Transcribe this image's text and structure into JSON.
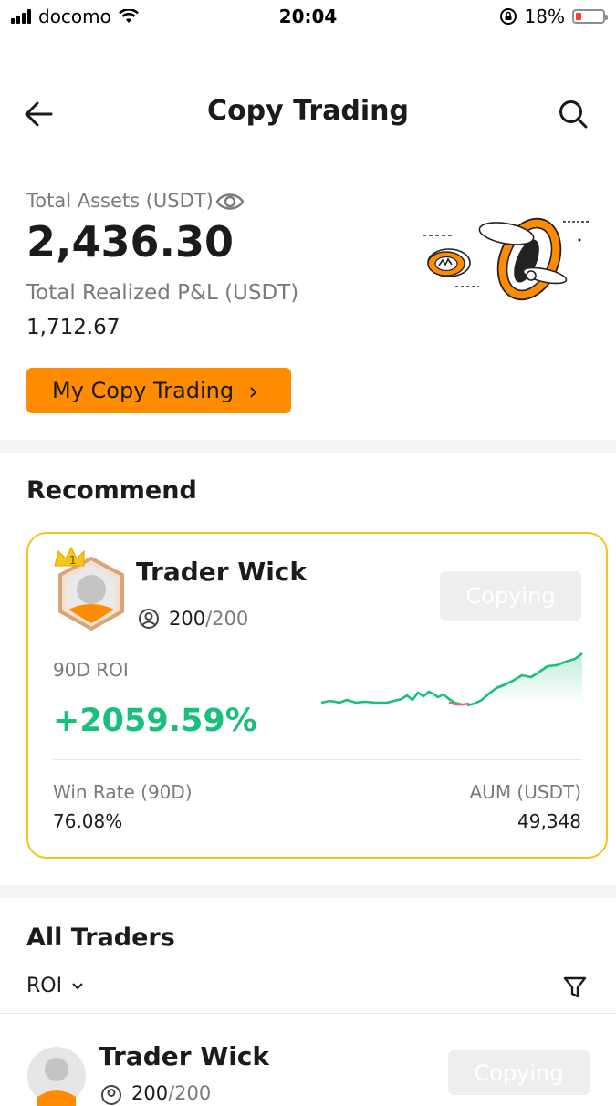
{
  "status_bar": {
    "carrier": "docomo",
    "time": "20:04",
    "battery": "18%",
    "battery_level": 0.18
  },
  "header": {
    "title": "Copy Trading",
    "back_icon": "arrow-left-icon",
    "search_icon": "search-icon"
  },
  "assets": {
    "total_label": "Total Assets (USDT)",
    "total_value": "2,436.30",
    "pnl_label": "Total Realized P&L (USDT)",
    "pnl_value": "1,712.67",
    "my_copy_label": "My Copy Trading",
    "chevron": "›"
  },
  "recommend": {
    "title": "Recommend",
    "trader": {
      "rank": "1",
      "name": "Trader Wick",
      "followers": "200",
      "followers_max": "/200",
      "button": "Copying",
      "roi_label": "90D ROI",
      "roi_value": "+2059.59%",
      "win_label": "Win Rate (90D)",
      "win_value": "76.08%",
      "aum_label": "AUM (USDT)",
      "aum_value": "49,348"
    }
  },
  "all_traders": {
    "title": "All Traders",
    "sort_label": "ROI",
    "filter_icon": "filter-icon",
    "first": {
      "name": "Trader Wick",
      "followers": "200",
      "followers_max": "/200",
      "button": "Copying"
    }
  },
  "colors": {
    "accent": "#ff8c00",
    "gain": "#19c07b",
    "loss": "#ff5b73",
    "card_border": "#f5c518"
  }
}
